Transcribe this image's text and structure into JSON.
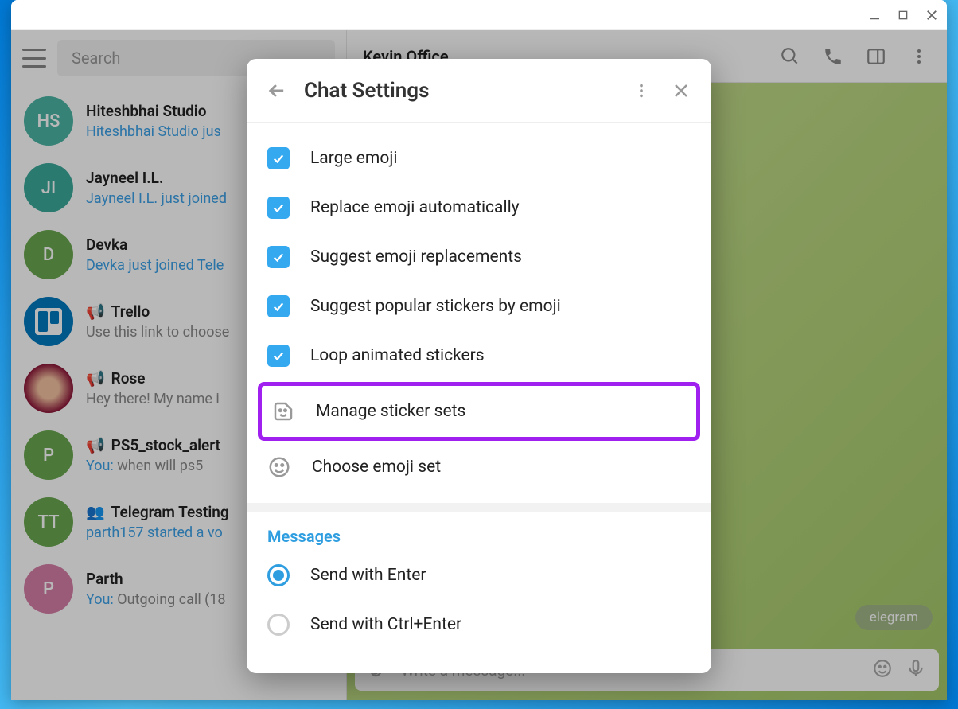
{
  "titlebar": {},
  "sidebar": {
    "search_placeholder": "Search",
    "chats": [
      {
        "initials": "HS",
        "color": "#4bb5a5",
        "name": "Hiteshbhai Studio",
        "preview": "Hiteshbhai Studio jus",
        "preview_type": "link"
      },
      {
        "initials": "JI",
        "color": "#3ba99c",
        "name": "Jayneel I.L.",
        "preview": "Jayneel I.L. just joined",
        "preview_type": "link"
      },
      {
        "initials": "D",
        "color": "#6aa84f",
        "name": "Devka",
        "preview": "Devka just joined Tele",
        "preview_type": "link"
      },
      {
        "initials": "",
        "color": "trello",
        "name": "Trello",
        "preview": "Use this link to choose",
        "preview_type": "gray",
        "speaker": true
      },
      {
        "initials": "",
        "color": "rose",
        "name": "Rose",
        "preview": "Hey there! My name i",
        "preview_type": "gray",
        "speaker": true
      },
      {
        "initials": "P",
        "color": "#6aa84f",
        "name": "PS5_stock_alert",
        "you": "You:",
        "msg": "when will ps5",
        "preview_type": "youmsg",
        "speaker": true
      },
      {
        "initials": "TT",
        "color": "#6aa84f",
        "name": "Telegram Testing",
        "preview": "parth157 started a vo",
        "preview_type": "link",
        "group": true
      },
      {
        "initials": "P",
        "color": "#d67fa8",
        "name": "Parth",
        "you": "You:",
        "msg": "Outgoing call (18",
        "preview_type": "youmsg"
      }
    ]
  },
  "chat": {
    "title": "Kevin Office",
    "composer_placeholder": "Write a message...",
    "badge": "elegram"
  },
  "modal": {
    "title": "Chat Settings",
    "options": [
      {
        "label": "Large emoji"
      },
      {
        "label": "Replace emoji automatically"
      },
      {
        "label": "Suggest emoji replacements"
      },
      {
        "label": "Suggest popular stickers by emoji"
      },
      {
        "label": "Loop animated stickers"
      }
    ],
    "manage_label": "Manage sticker sets",
    "emoji_set_label": "Choose emoji set",
    "section_messages": "Messages",
    "radio": [
      {
        "label": "Send with Enter",
        "on": true
      },
      {
        "label": "Send with Ctrl+Enter",
        "on": false
      }
    ]
  }
}
